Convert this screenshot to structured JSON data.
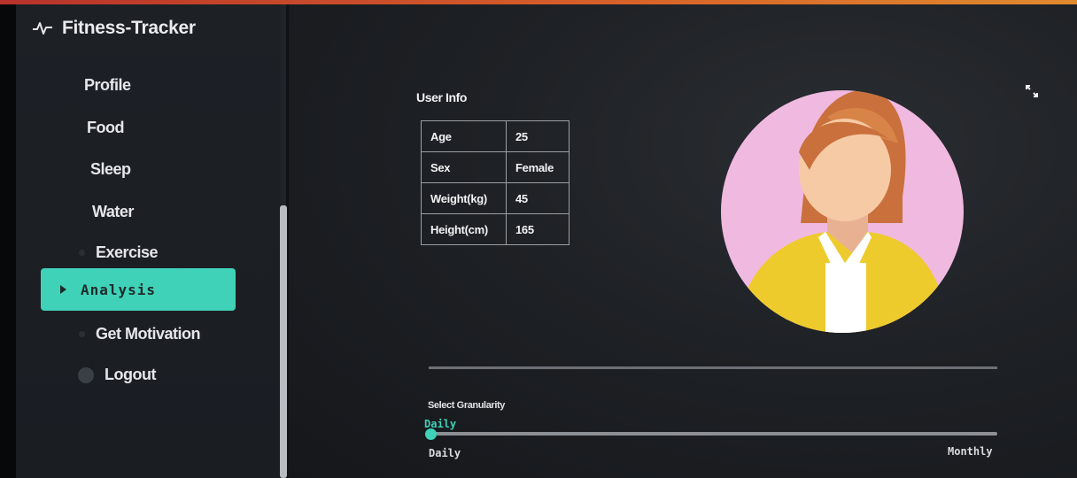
{
  "app": {
    "title": "Fitness-Tracker",
    "icon": "activity-pulse-icon"
  },
  "sidebar": {
    "items": [
      {
        "label": "Profile"
      },
      {
        "label": "Food"
      },
      {
        "label": "Sleep"
      },
      {
        "label": "Water"
      },
      {
        "label": "Exercise"
      },
      {
        "label": "Analysis",
        "active": true
      },
      {
        "label": "Get Motivation"
      },
      {
        "label": "Logout"
      }
    ]
  },
  "user_info": {
    "title": "User Info",
    "rows": [
      {
        "key": "Age",
        "value": "25"
      },
      {
        "key": "Sex",
        "value": "Female"
      },
      {
        "key": "Weight(kg)",
        "value": "45"
      },
      {
        "key": "Height(cm)",
        "value": "165"
      }
    ]
  },
  "avatar": {
    "icon": "female-avatar-icon"
  },
  "granularity": {
    "label": "Select Granularity",
    "current": "Daily",
    "min_label": "Daily",
    "max_label": "Monthly",
    "value_fraction": 0
  },
  "colors": {
    "accent": "#3fd2b8",
    "sidebar_bg": "#1d2126",
    "main_bg": "#1e2125",
    "top_bar": "#d8642a"
  }
}
